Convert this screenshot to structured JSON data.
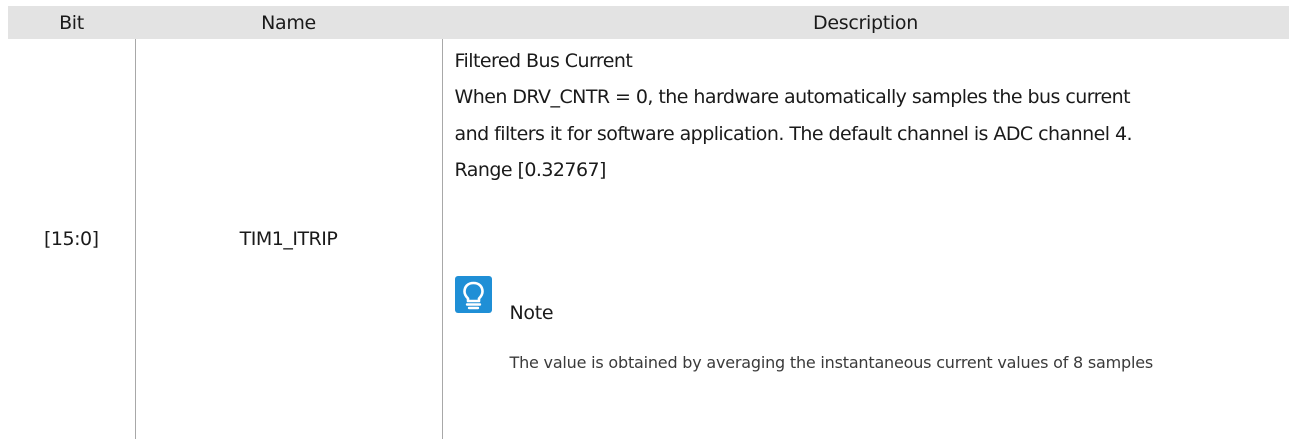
{
  "table": {
    "headers": {
      "bit": "Bit",
      "name": "Name",
      "description": "Description"
    },
    "rows": [
      {
        "bit": "[15:0]",
        "name": "TIM1_ITRIP",
        "description": {
          "title": "Filtered Bus Current",
          "lines": [
            "When DRV_CNTR = 0, the hardware automatically samples the bus current",
            "and filters it for software application. The default channel is ADC channel 4.",
            "Range [0.32767]"
          ],
          "note": {
            "icon": "lightbulb-icon",
            "icon_color": "#1f8fd6",
            "label": "Note",
            "text": "The value is obtained by averaging the instantaneous current values of 8 samples"
          }
        }
      }
    ]
  }
}
